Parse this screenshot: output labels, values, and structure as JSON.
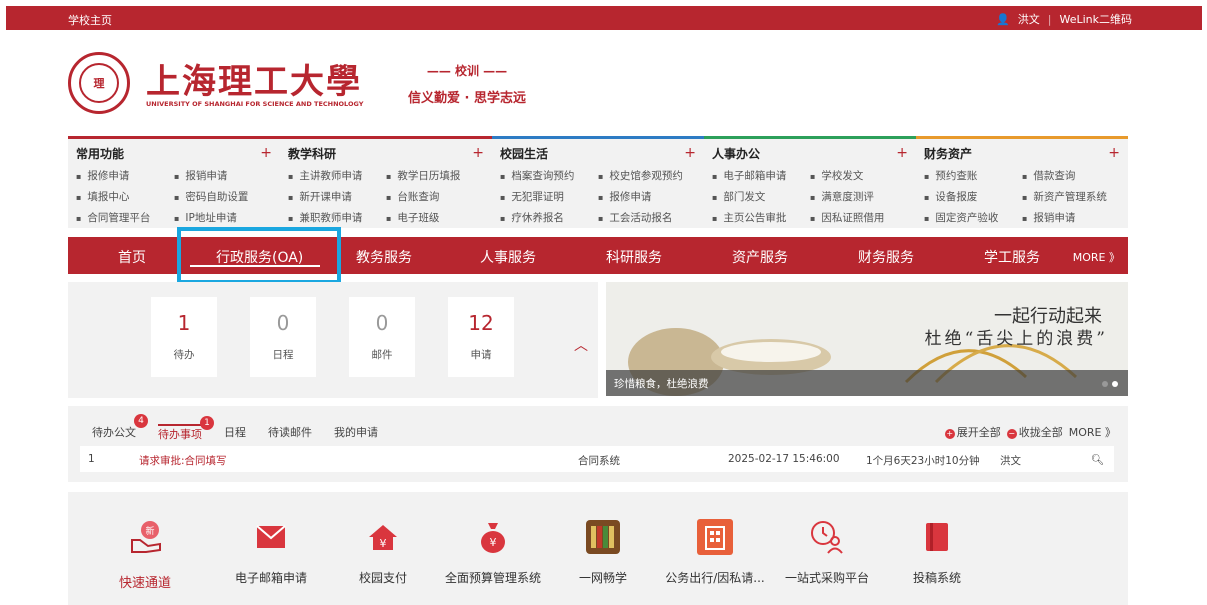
{
  "topbar": {
    "home": "学校主页",
    "user": "洪文",
    "welink": "WeLink二维码"
  },
  "header": {
    "school_name": "上海理工大學",
    "school_name_en": "UNIVERSITY OF SHANGHAI FOR SCIENCE AND TECHNOLOGY",
    "motto_title": "—— 校训 ——",
    "motto": "信义勤爱 · 思学志远"
  },
  "functions": [
    {
      "title": "常用功能",
      "color": "#b7262f",
      "items": [
        "报修申请",
        "报销申请",
        "填报中心",
        "密码自助设置",
        "合同管理平台",
        "IP地址申请"
      ]
    },
    {
      "title": "教学科研",
      "color": "#b7262f",
      "items": [
        "主讲教师申请",
        "教学日历填报",
        "新开课申请",
        "台账查询",
        "兼职教师申请",
        "电子班级"
      ]
    },
    {
      "title": "校园生活",
      "color": "#2d7bc4",
      "items": [
        "档案查询预约",
        "校史馆参观预约",
        "无犯罪证明",
        "报修申请",
        "疗休养报名",
        "工会活动报名"
      ]
    },
    {
      "title": "人事办公",
      "color": "#2ca05a",
      "items": [
        "电子邮箱申请",
        "学校发文",
        "部门发文",
        "满意度测评",
        "主页公告审批",
        "因私证照借用"
      ]
    },
    {
      "title": "财务资产",
      "color": "#e89a2c",
      "items": [
        "预约查账",
        "借款查询",
        "设备报废",
        "新资产管理系统",
        "固定资产验收",
        "报销申请"
      ]
    }
  ],
  "nav": {
    "items": [
      "首页",
      "行政服务(OA)",
      "教务服务",
      "人事服务",
      "科研服务",
      "资产服务",
      "财务服务",
      "学工服务"
    ],
    "more": "MORE 》"
  },
  "stats": [
    {
      "value": "1",
      "label": "待办",
      "color": "#b7262f"
    },
    {
      "value": "0",
      "label": "日程",
      "color": "#999999"
    },
    {
      "value": "0",
      "label": "邮件",
      "color": "#999999"
    },
    {
      "value": "12",
      "label": "申请",
      "color": "#b7262f"
    }
  ],
  "banner": {
    "line1": "一起行动起来",
    "line2": "杜绝“舌尖上的浪费”",
    "caption": "珍惜粮食，杜绝浪费"
  },
  "tasks": {
    "tabs": [
      {
        "label": "待办公文",
        "badge": "4"
      },
      {
        "label": "待办事项",
        "badge": "1"
      },
      {
        "label": "日程",
        "badge": ""
      },
      {
        "label": "待读邮件",
        "badge": ""
      },
      {
        "label": "我的申请",
        "badge": ""
      }
    ],
    "expand_all": "展开全部",
    "collapse_all": "收拢全部",
    "more": "MORE 》",
    "rows": [
      {
        "no": "1",
        "title": "请求审批:合同填写",
        "system": "合同系统",
        "time": "2025-02-17 15:46:00",
        "duration": "1个月6天23小时10分钟",
        "user": "洪文"
      }
    ]
  },
  "quick": [
    {
      "label": "快速通道",
      "icon": "quick-channel-icon"
    },
    {
      "label": "电子邮箱申请",
      "icon": "mail-icon"
    },
    {
      "label": "校园支付",
      "icon": "campus-pay-icon"
    },
    {
      "label": "全面预算管理系统",
      "icon": "money-bag-icon"
    },
    {
      "label": "一网畅学",
      "icon": "books-icon"
    },
    {
      "label": "公务出行/因私请...",
      "icon": "building-icon"
    },
    {
      "label": "一站式采购平台",
      "icon": "purchase-icon"
    },
    {
      "label": "投稿系统",
      "icon": "book-icon"
    }
  ]
}
